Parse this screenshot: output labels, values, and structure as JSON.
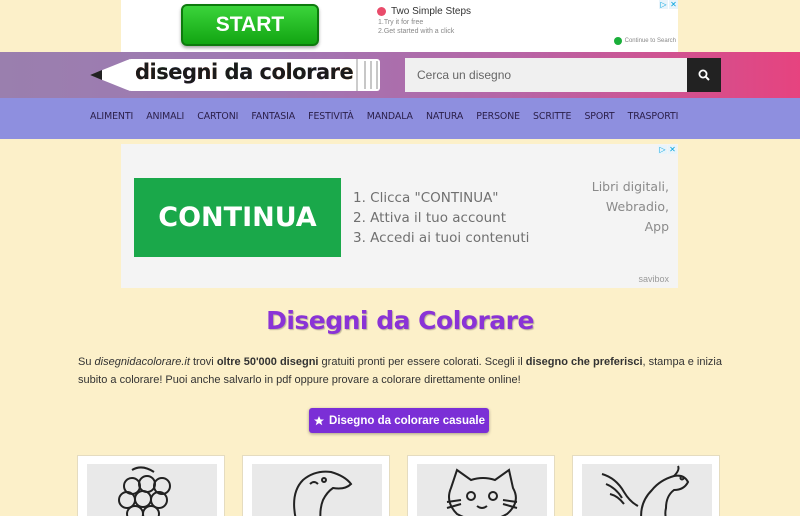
{
  "top_ad": {
    "button": "START",
    "title": "Two Simple Steps",
    "steps": [
      "1.Try it for free",
      "2.Get started with a click"
    ],
    "continue_text": "Continue to Search"
  },
  "header": {
    "logo_letters": [
      "d",
      "i",
      "s",
      "e",
      "g",
      "n",
      "i",
      " ",
      "d",
      "a",
      " ",
      "c",
      "o",
      "l",
      "o",
      "r",
      "a",
      "r",
      "e"
    ],
    "logo_colors": [
      "#e23b2c",
      "#f08c1d",
      "#2c9c3a",
      "#2a65c8",
      "#8a3cc4",
      "#e23b2c",
      "#f08c1d",
      "#ffffff",
      "#2c9c3a",
      "#2a65c8",
      "#ffffff",
      "#8a3cc4",
      "#e23b2c",
      "#f08c1d",
      "#2c9c3a",
      "#2a65c8",
      "#8a3cc4",
      "#e23b2c",
      "#f08c1d"
    ],
    "search_placeholder": "Cerca un disegno"
  },
  "nav": {
    "items": [
      "ALIMENTI",
      "ANIMALI",
      "CARTONI",
      "FANTASIA",
      "FESTIVITÀ",
      "MANDALA",
      "NATURA",
      "PERSONE",
      "SCRITTE",
      "SPORT",
      "TRASPORTI"
    ]
  },
  "mid_ad": {
    "button": "CONTINUA",
    "steps": [
      "1. Clicca \"CONTINUA\"",
      "2. Attiva il tuo account",
      "3. Accedi ai tuoi contenuti"
    ],
    "right_lines": [
      "Libri digitali,",
      "Webradio,",
      "App"
    ],
    "brand": "savibox"
  },
  "main": {
    "title": "Disegni da Colorare",
    "intro": {
      "p1": "Su ",
      "site": "disegnidacolorare.it",
      "p2": " trovi ",
      "b1": "oltre 50'000 disegni",
      "p3": " gratuiti pronti per essere colorati. Scegli il ",
      "b2": "disegno che preferisci",
      "p4": ", stampa e inizia subito a colorare! Puoi anche salvarlo in pdf oppure provare a colorare direttamente online!"
    },
    "random_button": "Disegno da colorare casuale"
  },
  "cards": [
    {
      "subject": "grapes"
    },
    {
      "subject": "camel"
    },
    {
      "subject": "cat"
    },
    {
      "subject": "pegasus"
    }
  ],
  "colors": {
    "background": "#fcf0c9",
    "nav": "#8e8fdf",
    "accent": "#7b2fd6",
    "ad_green": "#1aa84a"
  }
}
